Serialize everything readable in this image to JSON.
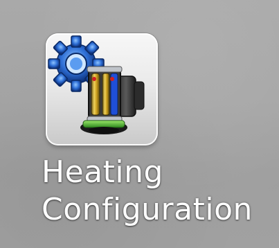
{
  "desktop": {
    "icon": {
      "label_line1": "Heating",
      "label_line2": "Configuration",
      "icon": "heating-configuration-icon",
      "colors": {
        "gear": "#2e6fd6",
        "tile": "#e9e9e9",
        "label": "#ffffff"
      }
    }
  }
}
